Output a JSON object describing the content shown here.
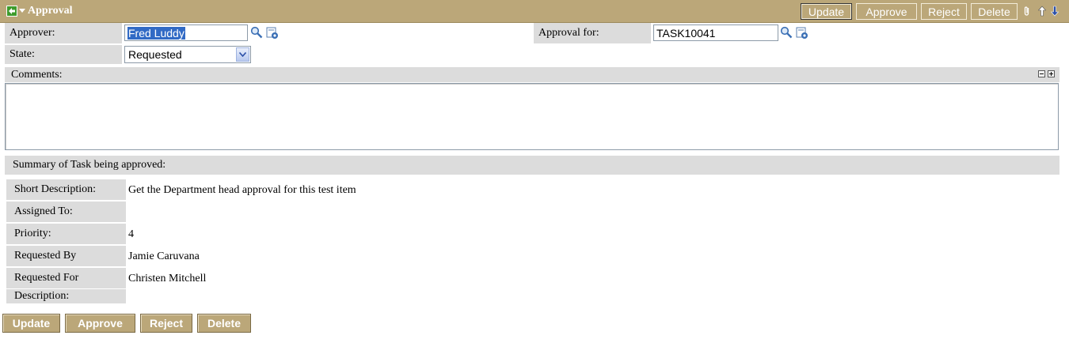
{
  "header": {
    "title": "Approval",
    "buttons": {
      "update": "Update",
      "approve": "Approve",
      "reject": "Reject",
      "delete": "Delete"
    }
  },
  "form": {
    "approver_label": "Approver:",
    "approver_value": "Fred Luddy",
    "approval_for_label": "Approval for:",
    "approval_for_value": "TASK10041",
    "state_label": "State:",
    "state_value": "Requested",
    "comments_label": "Comments:"
  },
  "summary": {
    "heading": "Summary of Task being approved:",
    "rows": [
      {
        "label": "Short Description:",
        "value": "Get the Department head approval for this test item"
      },
      {
        "label": "Assigned To:",
        "value": ""
      },
      {
        "label": "Priority:",
        "value": "4"
      },
      {
        "label": "Requested By",
        "value": "Jamie Caruvana"
      },
      {
        "label": "Requested For",
        "value": "Christen Mitchell"
      },
      {
        "label": "Description:",
        "value": ""
      }
    ]
  },
  "footer": {
    "update": "Update",
    "approve": "Approve",
    "reject": "Reject",
    "delete": "Delete"
  },
  "colors": {
    "header_bg": "#bba779",
    "label_bg": "#dcdcdc",
    "selection": "#316ac5"
  },
  "icons": [
    "back-arrow-icon",
    "menu-arrow-icon",
    "paperclip-icon",
    "up-arrow-icon",
    "down-arrow-icon",
    "magnifier-icon",
    "reference-icon",
    "collapse-icon",
    "expand-icon"
  ]
}
